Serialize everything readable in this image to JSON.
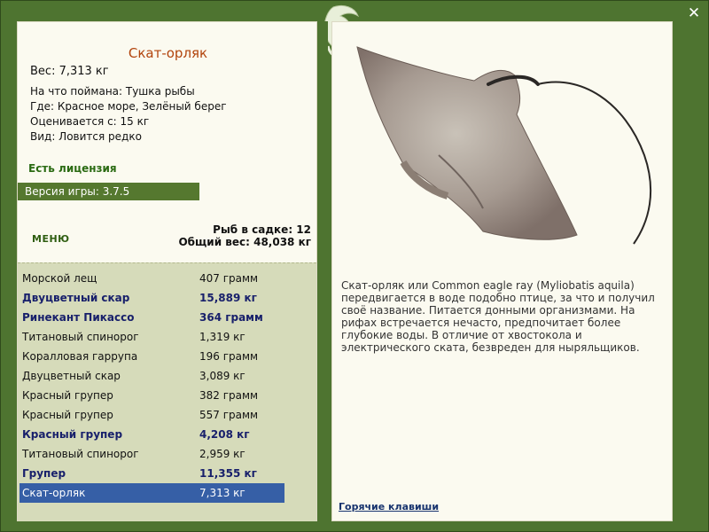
{
  "colors": {
    "frame": "#4e7430",
    "panel": "#fbfaf0",
    "title": "#b2440d",
    "bold_row": "#18206b",
    "selected_row": "#365fa6"
  },
  "fish": {
    "title": "Скат-орляк",
    "weight": "Вес: 7,313 кг",
    "bait": "На что поймана: Тушка рыбы",
    "location": "Где: Красное море, Зелёный берег",
    "value": "Оценивается с: 15 кг",
    "type": "Вид: Ловится редко",
    "description": "Скат-орляк или Common eagle ray (Myliobatis aquila) передвигается в воде подобно птице, за что и получил своё название. Питается донными организмами. На рифах встречается нечасто, предпочитает более глубокие воды. В отличие от хвостокола и электрического ската, безвреден для ныряльщиков."
  },
  "license": "Есть лицензия",
  "version": "Версия игры: 3.7.5",
  "menu_label": "МЕНЮ",
  "stats": {
    "count": "Рыб в садке: 12",
    "total": "Общий вес: 48,038 кг"
  },
  "catch": [
    {
      "name": "Морской лещ",
      "weight": "407 грамм",
      "bold": false,
      "selected": false
    },
    {
      "name": "Двуцветный скар",
      "weight": "15,889 кг",
      "bold": true,
      "selected": false
    },
    {
      "name": "Ринекант Пикассо",
      "weight": "364 грамм",
      "bold": true,
      "selected": false
    },
    {
      "name": "Титановый спинорог",
      "weight": "1,319 кг",
      "bold": false,
      "selected": false
    },
    {
      "name": "Коралловая гаррупа",
      "weight": "196 грамм",
      "bold": false,
      "selected": false
    },
    {
      "name": "Двуцветный скар",
      "weight": "3,089 кг",
      "bold": false,
      "selected": false
    },
    {
      "name": "Красный групер",
      "weight": "382 грамм",
      "bold": false,
      "selected": false
    },
    {
      "name": "Красный групер",
      "weight": "557 грамм",
      "bold": false,
      "selected": false
    },
    {
      "name": "Красный групер",
      "weight": "4,208 кг",
      "bold": true,
      "selected": false
    },
    {
      "name": "Титановый спинорог",
      "weight": "2,959 кг",
      "bold": false,
      "selected": false
    },
    {
      "name": "Групер",
      "weight": "11,355 кг",
      "bold": true,
      "selected": false
    },
    {
      "name": "Скат-орляк",
      "weight": "7,313 кг",
      "bold": false,
      "selected": true
    }
  ],
  "hotkeys": "Горячие клавиши",
  "close_icon": "close-x-icon",
  "logo_icon": "dolphin-logo-icon"
}
